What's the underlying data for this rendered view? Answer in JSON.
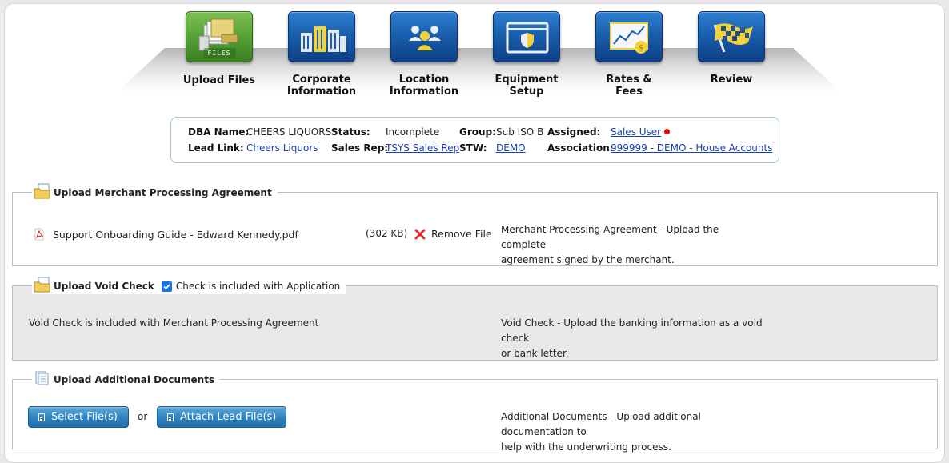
{
  "wizard": {
    "steps": [
      {
        "label": "Upload Files",
        "icon": "files-icon",
        "tile_text": "FILES",
        "active": true
      },
      {
        "label": "Corporate\nInformation",
        "icon": "buildings-icon"
      },
      {
        "label": "Location\nInformation",
        "icon": "people-icon"
      },
      {
        "label": "Equipment\nSetup",
        "icon": "secure-browser-icon"
      },
      {
        "label": "Rates &\nFees",
        "icon": "rates-chart-icon"
      },
      {
        "label": "Review",
        "icon": "checkered-flag-icon"
      }
    ]
  },
  "info": {
    "dba_label": "DBA Name:",
    "dba_value": "CHEERS LIQUORS",
    "status_label": "Status:",
    "status_value": "Incomplete",
    "group_label": "Group:",
    "group_value": "Sub ISO B",
    "assigned_label": "Assigned:",
    "assigned_value": "Sales User",
    "lead_label": "Lead Link:",
    "lead_value": "Cheers Liquors",
    "salesrep_label": "Sales Rep:",
    "salesrep_value": "TSYS Sales Rep",
    "stw_label": "STW:",
    "stw_value": "DEMO",
    "association_label": "Association:",
    "association_value": "999999 - DEMO - House Accounts"
  },
  "mpa": {
    "legend": "Upload Merchant Processing Agreement",
    "file_name": "Support Onboarding Guide - Edward Kennedy.pdf",
    "file_size": "(302 KB)",
    "remove_label": "Remove File",
    "help_line1": "Merchant Processing Agreement - Upload the complete",
    "help_line2": "agreement signed by the merchant."
  },
  "void": {
    "legend": "Upload Void Check",
    "checkbox_label": "Check is included with Application",
    "checked": true,
    "note": "Void Check is included with Merchant Processing Agreement",
    "help_line1": "Void Check - Upload the banking information as a void check",
    "help_line2": "or bank letter."
  },
  "additional": {
    "legend": "Upload Additional Documents",
    "select_label": "Select File(s)",
    "or_label": "or",
    "attach_label": "Attach Lead File(s)",
    "help_line1": "Additional Documents - Upload additional documentation to",
    "help_line2": "help with the underwriting process."
  },
  "colors": {
    "accent_blue": "#1a5fae",
    "active_green": "#56a236",
    "link": "#1a3fb5",
    "status_dot": "#e00000",
    "button": "#2f82bf"
  }
}
